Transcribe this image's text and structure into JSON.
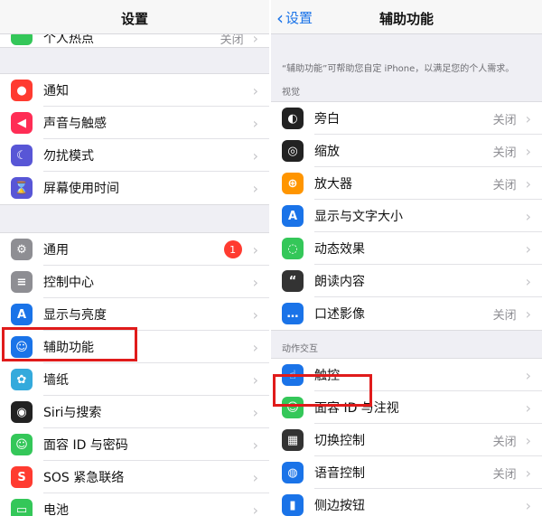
{
  "left": {
    "title": "设置",
    "top_row": {
      "label": "个人热点",
      "value": "关闭"
    },
    "group1": [
      {
        "label": "通知",
        "icon": "notification-icon",
        "color": "#ff3b30"
      },
      {
        "label": "声音与触感",
        "icon": "sound-icon",
        "color": "#ff2d55"
      },
      {
        "label": "勿扰模式",
        "icon": "moon-icon",
        "color": "#5856d6"
      },
      {
        "label": "屏幕使用时间",
        "icon": "hourglass-icon",
        "color": "#5856d6"
      }
    ],
    "group2": [
      {
        "label": "通用",
        "icon": "gear-icon",
        "color": "#8e8e93",
        "badge": "1"
      },
      {
        "label": "控制中心",
        "icon": "control-center-icon",
        "color": "#8e8e93"
      },
      {
        "label": "显示与亮度",
        "icon": "display-icon",
        "color": "#1a73e8"
      },
      {
        "label": "辅助功能",
        "icon": "accessibility-icon",
        "color": "#1a73e8"
      },
      {
        "label": "墙纸",
        "icon": "wallpaper-icon",
        "color": "#34aadc"
      },
      {
        "label": "Siri与搜索",
        "icon": "siri-icon",
        "color": "#222222"
      },
      {
        "label": "面容 ID 与密码",
        "icon": "face-id-icon",
        "color": "#34c759"
      },
      {
        "label": "SOS 紧急联络",
        "icon": "sos-icon",
        "color": "#ff3b30"
      },
      {
        "label": "电池",
        "icon": "battery-icon",
        "color": "#34c759"
      }
    ]
  },
  "right": {
    "back_label": "设置",
    "title": "辅助功能",
    "description": "“辅助功能”可帮助您自定 iPhone，以满足您的个人需求。",
    "section_vision": "视觉",
    "vision_rows": [
      {
        "label": "旁白",
        "value": "关闭",
        "icon": "voiceover-icon",
        "color": "#222222"
      },
      {
        "label": "缩放",
        "value": "关闭",
        "icon": "zoom-icon",
        "color": "#222222"
      },
      {
        "label": "放大器",
        "value": "关闭",
        "icon": "magnifier-icon",
        "color": "#ff9500"
      },
      {
        "label": "显示与文字大小",
        "value": "",
        "icon": "text-size-icon",
        "color": "#1a73e8"
      },
      {
        "label": "动态效果",
        "value": "",
        "icon": "motion-icon",
        "color": "#34c759"
      },
      {
        "label": "朗读内容",
        "value": "",
        "icon": "spoken-content-icon",
        "color": "#333333"
      },
      {
        "label": "口述影像",
        "value": "关闭",
        "icon": "audio-description-icon",
        "color": "#1a73e8"
      }
    ],
    "section_interaction": "动作交互",
    "interaction_rows": [
      {
        "label": "触控",
        "value": "",
        "icon": "touch-icon",
        "color": "#1a73e8"
      },
      {
        "label": "面容 ID 与注视",
        "value": "",
        "icon": "face-id-attention-icon",
        "color": "#34c759"
      },
      {
        "label": "切换控制",
        "value": "关闭",
        "icon": "switch-control-icon",
        "color": "#333333"
      },
      {
        "label": "语音控制",
        "value": "关闭",
        "icon": "voice-control-icon",
        "color": "#1a73e8"
      },
      {
        "label": "侧边按钮",
        "value": "",
        "icon": "side-button-icon",
        "color": "#1a73e8"
      }
    ]
  }
}
